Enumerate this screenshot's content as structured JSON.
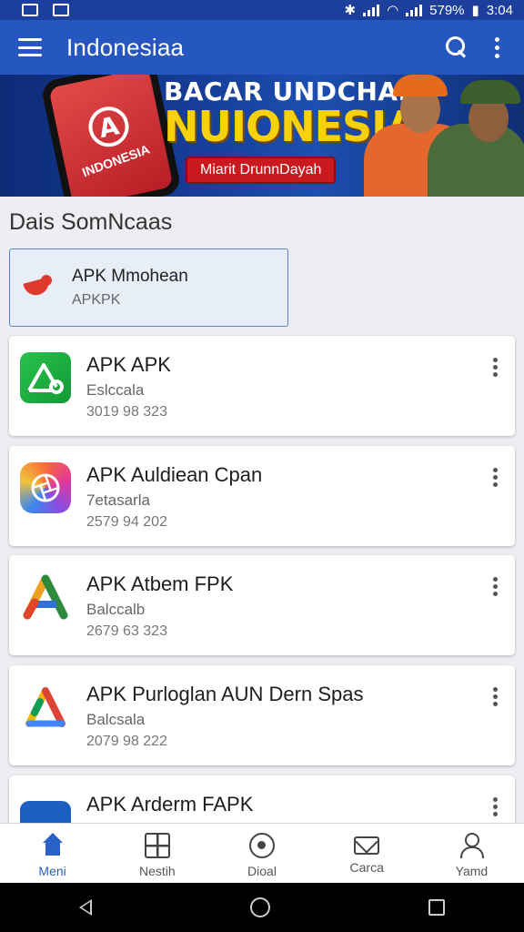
{
  "status_bar": {
    "battery": "579%",
    "time": "3:04"
  },
  "app_bar": {
    "title": "Indonesiaa"
  },
  "banner": {
    "line1": "BACAR UNDCHAN",
    "line2": "NUIONESIA",
    "cta": "Miarit DrunnDayah",
    "phone_text": "INDONESIA",
    "phone_logo": "A"
  },
  "section": {
    "title": "Dais SomNcaas"
  },
  "featured": {
    "name": "APK Mmohean",
    "sub": "APKPK"
  },
  "apps": [
    {
      "name": "APK APK",
      "developer": "Eslccala",
      "meta": "3019 98 323",
      "icon": "green-a-icon"
    },
    {
      "name": "APK Auldiean Cpan",
      "developer": "7etasarla",
      "meta": "2579 94 202",
      "icon": "rainbow-aperture-icon"
    },
    {
      "name": "APK Atbem FPK",
      "developer": "Balccalb",
      "meta": "2679 63 323",
      "icon": "multicolor-a-icon"
    },
    {
      "name": "APK Purloglan AUN Dern Spas",
      "developer": "Balcsala",
      "meta": "2079 98 222",
      "icon": "google-a-icon"
    },
    {
      "name": "APK Arderm FAPK",
      "developer": "",
      "meta": "",
      "icon": "blue-app-icon"
    }
  ],
  "bottom_nav": [
    {
      "label": "Meni",
      "icon": "home-icon",
      "active": true
    },
    {
      "label": "Nestih",
      "icon": "grid-icon",
      "active": false
    },
    {
      "label": "Dioal",
      "icon": "disc-icon",
      "active": false
    },
    {
      "label": "Carca",
      "icon": "mail-icon",
      "active": false
    },
    {
      "label": "Yamd",
      "icon": "user-icon",
      "active": false
    }
  ]
}
